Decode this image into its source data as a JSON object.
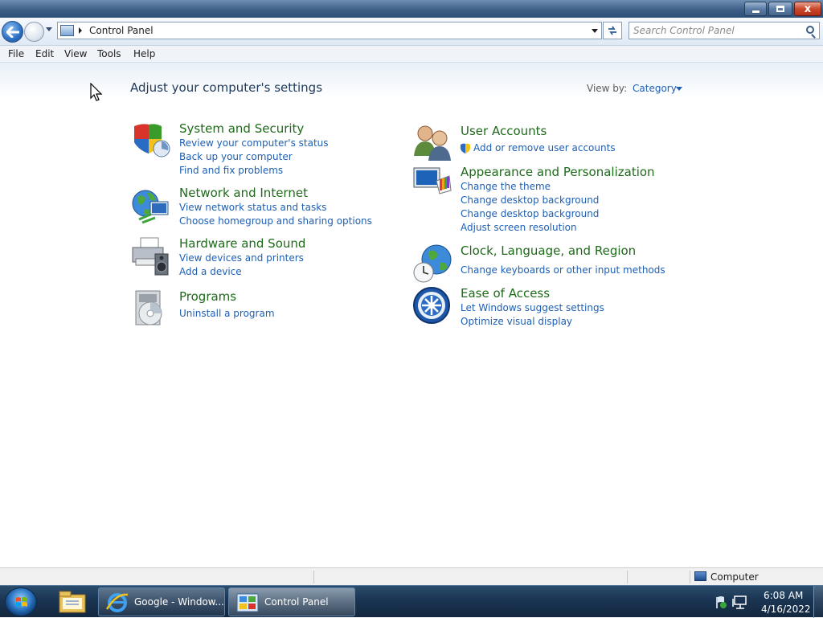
{
  "window": {
    "minimize_label": "–",
    "maximize_label": "",
    "close_label": "x"
  },
  "address": {
    "breadcrumb": "Control Panel",
    "search_placeholder": "Search Control Panel"
  },
  "menu": [
    "File",
    "Edit",
    "View",
    "Tools",
    "Help"
  ],
  "content": {
    "heading": "Adjust your computer's settings",
    "view_by_label": "View by:",
    "view_by_value": "Category"
  },
  "categories": [
    {
      "title": "System and Security",
      "icon": "shield-icon",
      "links": [
        "Review your computer's status",
        "Back up your computer",
        "Find and fix problems"
      ]
    },
    {
      "title": "Network and Internet",
      "icon": "network-globe-icon",
      "links": [
        "View network status and tasks",
        "Choose homegroup and sharing options"
      ]
    },
    {
      "title": "Hardware and Sound",
      "icon": "printer-speaker-icon",
      "links": [
        "View devices and printers",
        "Add a device"
      ]
    },
    {
      "title": "Programs",
      "icon": "programs-disc-icon",
      "links": [
        "Uninstall a program"
      ]
    },
    {
      "title": "User Accounts",
      "icon": "users-icon",
      "links": [
        "Add or remove user accounts"
      ]
    },
    {
      "title": "Appearance and Personalization",
      "icon": "monitor-palette-icon",
      "links": [
        "Change the theme",
        "Change desktop background",
        "Change desktop background",
        "Adjust screen resolution"
      ]
    },
    {
      "title": "Clock, Language, and Region",
      "icon": "clock-globe-icon",
      "links": [
        "Change keyboards or other input methods"
      ]
    },
    {
      "title": "Ease of Access",
      "icon": "ease-of-access-icon",
      "links": [
        "Let Windows suggest settings",
        "Optimize visual display"
      ]
    }
  ],
  "status": {
    "location": "Computer"
  },
  "taskbar": {
    "tasks": [
      "Google - Window...",
      "Control Panel"
    ],
    "time": "6:08 AM",
    "date": "4/16/2022"
  }
}
